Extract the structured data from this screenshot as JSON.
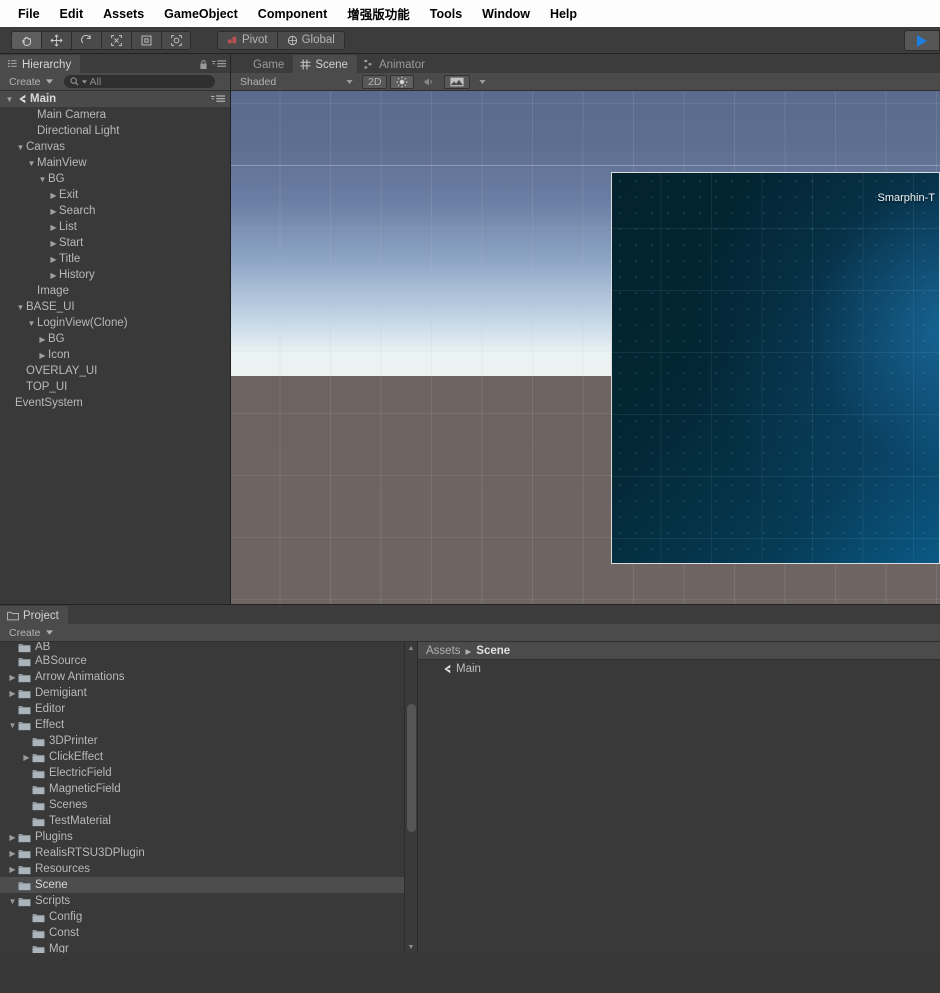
{
  "menubar": {
    "items": [
      {
        "label": "File"
      },
      {
        "label": "Edit"
      },
      {
        "label": "Assets"
      },
      {
        "label": "GameObject"
      },
      {
        "label": "Component"
      },
      {
        "label": "增强版功能"
      },
      {
        "label": "Tools"
      },
      {
        "label": "Window"
      },
      {
        "label": "Help"
      }
    ]
  },
  "toolbar": {
    "tools": [
      {
        "name": "hand-tool",
        "active": true
      },
      {
        "name": "move-tool",
        "active": false
      },
      {
        "name": "rotate-tool",
        "active": false
      },
      {
        "name": "scale-tool",
        "active": false
      },
      {
        "name": "rect-tool",
        "active": false
      },
      {
        "name": "transform-tool",
        "active": false
      }
    ],
    "pivot_label": "Pivot",
    "global_label": "Global",
    "play_label": "▶"
  },
  "hierarchy": {
    "tab_label": "Hierarchy",
    "create_label": "Create",
    "search_placeholder": "All",
    "search_value": "",
    "scene_name": "Main",
    "items": [
      {
        "label": "Main",
        "depth": 0,
        "fold": "down",
        "icon": "unity-scene-icon",
        "root": true
      },
      {
        "label": "Main Camera",
        "depth": 2,
        "fold": "none"
      },
      {
        "label": "Directional Light",
        "depth": 2,
        "fold": "none"
      },
      {
        "label": "Canvas",
        "depth": 1,
        "fold": "down"
      },
      {
        "label": "MainView",
        "depth": 2,
        "fold": "down"
      },
      {
        "label": "BG",
        "depth": 3,
        "fold": "down"
      },
      {
        "label": "Exit",
        "depth": 4,
        "fold": "right"
      },
      {
        "label": "Search",
        "depth": 4,
        "fold": "right"
      },
      {
        "label": "List",
        "depth": 4,
        "fold": "right"
      },
      {
        "label": "Start",
        "depth": 4,
        "fold": "right"
      },
      {
        "label": "Title",
        "depth": 4,
        "fold": "right"
      },
      {
        "label": "History",
        "depth": 4,
        "fold": "right"
      },
      {
        "label": "Image",
        "depth": 2,
        "fold": "none"
      },
      {
        "label": "BASE_UI",
        "depth": 1,
        "fold": "down"
      },
      {
        "label": "LoginView(Clone)",
        "depth": 2,
        "fold": "down"
      },
      {
        "label": "BG",
        "depth": 3,
        "fold": "right"
      },
      {
        "label": "Icon",
        "depth": 3,
        "fold": "right"
      },
      {
        "label": "OVERLAY_UI",
        "depth": 1,
        "fold": "none"
      },
      {
        "label": "TOP_UI",
        "depth": 1,
        "fold": "none"
      },
      {
        "label": "EventSystem",
        "depth": 0,
        "fold": "none"
      }
    ]
  },
  "sceneview": {
    "tabs": [
      {
        "label": "Game",
        "icon": "game-icon",
        "active": false
      },
      {
        "label": "Scene",
        "icon": "scene-grid-icon",
        "active": true
      },
      {
        "label": "Animator",
        "icon": "animator-icon",
        "active": false
      }
    ],
    "shading_mode": "Shaded",
    "mode_2d": "2D",
    "lighting_on": true,
    "audio_on": false,
    "ui_panel_title": "Smarphin-T"
  },
  "project": {
    "tab_label": "Project",
    "create_label": "Create",
    "breadcrumb_root": "Assets",
    "breadcrumb_current": "Scene",
    "breadcrumb_sep": "▸",
    "assets": [
      {
        "label": "Main",
        "icon": "unity-scene-icon"
      }
    ],
    "tree": [
      {
        "label": "AB",
        "depth": 1,
        "fold": "none",
        "clipped": true
      },
      {
        "label": "ABSource",
        "depth": 1,
        "fold": "none"
      },
      {
        "label": "Arrow Animations",
        "depth": 1,
        "fold": "right"
      },
      {
        "label": "Demigiant",
        "depth": 1,
        "fold": "right"
      },
      {
        "label": "Editor",
        "depth": 1,
        "fold": "none"
      },
      {
        "label": "Effect",
        "depth": 1,
        "fold": "down"
      },
      {
        "label": "3DPrinter",
        "depth": 2,
        "fold": "none"
      },
      {
        "label": "ClickEffect",
        "depth": 2,
        "fold": "right"
      },
      {
        "label": "ElectricField",
        "depth": 2,
        "fold": "none"
      },
      {
        "label": "MagneticField",
        "depth": 2,
        "fold": "none"
      },
      {
        "label": "Scenes",
        "depth": 2,
        "fold": "none"
      },
      {
        "label": "TestMaterial",
        "depth": 2,
        "fold": "none"
      },
      {
        "label": "Plugins",
        "depth": 1,
        "fold": "right"
      },
      {
        "label": "RealisRTSU3DPlugin",
        "depth": 1,
        "fold": "right"
      },
      {
        "label": "Resources",
        "depth": 1,
        "fold": "right"
      },
      {
        "label": "Scene",
        "depth": 1,
        "fold": "none",
        "selected": true
      },
      {
        "label": "Scripts",
        "depth": 1,
        "fold": "down"
      },
      {
        "label": "Config",
        "depth": 2,
        "fold": "none"
      },
      {
        "label": "Const",
        "depth": 2,
        "fold": "none"
      },
      {
        "label": "Mgr",
        "depth": 2,
        "fold": "none"
      }
    ]
  },
  "colors": {
    "panel_bg": "#393939",
    "toolbar_bg": "#4b4b4b",
    "chrome_bg": "#3c3c3c",
    "text": "#b9b9b9",
    "selection": "#4d4d4d",
    "play_accent": "#1f7fe0",
    "sky_top": "#5b6b8e",
    "sky_horizon": "#edf2ef",
    "ground": "#6d6461",
    "ui_panel_deep": "#02222e",
    "ui_panel_glow": "#0a5a86"
  }
}
